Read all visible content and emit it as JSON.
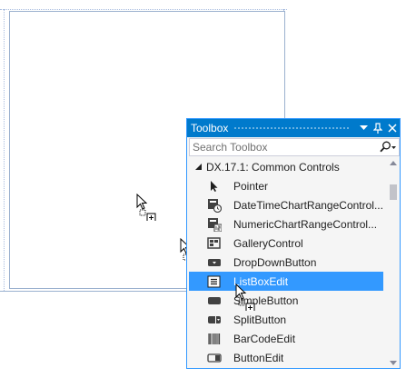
{
  "toolbox": {
    "title": "Toolbox",
    "controls": {
      "dropdown_icon": "dropdown-triangle-icon",
      "pin_icon": "pin-icon",
      "close_icon": "close-icon"
    },
    "search": {
      "placeholder": "Search Toolbox",
      "value": ""
    },
    "group": {
      "label": "DX.17.1: Common Controls",
      "expanded": true
    },
    "items": [
      {
        "label": "Pointer",
        "icon": "pointer-icon",
        "selected": false
      },
      {
        "label": "DateTimeChartRangeControl...",
        "icon": "datetime-chart-range-icon",
        "selected": false
      },
      {
        "label": "NumericChartRangeControl...",
        "icon": "numeric-chart-range-icon",
        "selected": false
      },
      {
        "label": "GalleryControl",
        "icon": "gallery-icon",
        "selected": false
      },
      {
        "label": "DropDownButton",
        "icon": "dropdown-button-icon",
        "selected": false
      },
      {
        "label": "ListBoxEdit",
        "icon": "listbox-icon",
        "selected": true
      },
      {
        "label": "SimpleButton",
        "icon": "simple-button-icon",
        "selected": false
      },
      {
        "label": "SplitButton",
        "icon": "split-button-icon",
        "selected": false
      },
      {
        "label": "BarCodeEdit",
        "icon": "barcode-icon",
        "selected": false
      },
      {
        "label": "ButtonEdit",
        "icon": "button-edit-icon",
        "selected": false
      }
    ]
  },
  "colors": {
    "accent": "#007acc",
    "selection": "#3399ff",
    "border": "#3399ff",
    "panel_bg": "#f5f5f5",
    "form_outline": "#9bb1cf"
  }
}
